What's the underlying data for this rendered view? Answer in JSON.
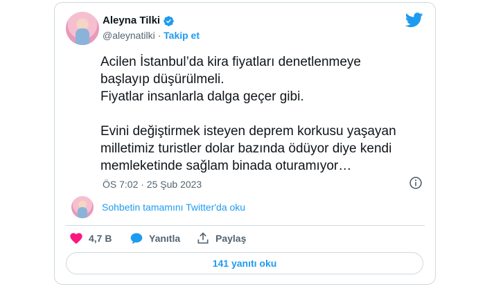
{
  "author": {
    "name": "Aleyna Tilki",
    "handle": "@aleynatilki",
    "separator": "·",
    "follow_label": "Takip et"
  },
  "tweet": {
    "paragraphs": [
      "Acilen İstanbul’da kira fiyatları denetlenmeye\nbaşlayıp düşürülmeli.\nFiyatlar insanlarla dalga geçer gibi.",
      "Evini değiştirmek isteyen deprem korkusu yaşayan\nmilletimiz turistler dolar bazında ödüyor diye kendi\nmemleketinde sağlam binada oturamıyor…"
    ],
    "timestamp": "ÖS 7:02 · 25 Şub 2023"
  },
  "thread_link": "Sohbetin tamamını Twitter'da oku",
  "actions": {
    "like_count": "4,7 B",
    "reply_label": "Yanıtla",
    "share_label": "Paylaş"
  },
  "replies_button": "141 yanıtı oku",
  "icons": {
    "verified": "verified-badge-icon",
    "logo": "twitter-bird-icon",
    "info": "info-icon",
    "like": "heart-icon",
    "reply": "speech-bubble-icon",
    "share": "share-icon"
  },
  "colors": {
    "accent": "#1d9bf0",
    "like": "#f91880",
    "muted": "#536471",
    "border": "#cfd9de"
  }
}
